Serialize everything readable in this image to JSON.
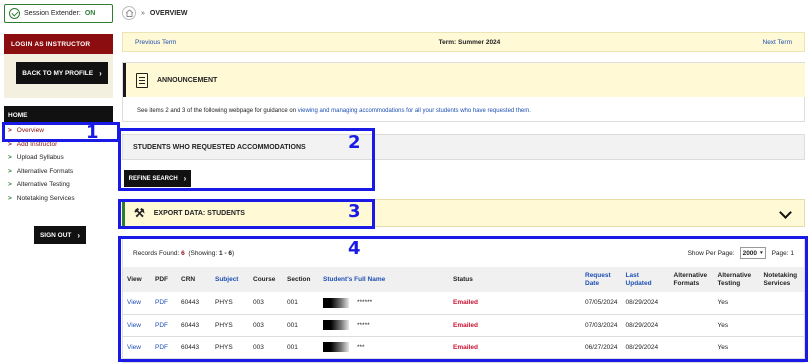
{
  "session": {
    "label": "Session Extender:",
    "state": "ON"
  },
  "sidebar": {
    "instructor_header": "LOGIN AS INSTRUCTOR",
    "back_button": "BACK TO MY PROFILE",
    "home_header": "HOME",
    "items": [
      {
        "label": "Overview"
      },
      {
        "label": "Add Instructor"
      },
      {
        "label": "Upload Syllabus"
      },
      {
        "label": "Alternative Formats"
      },
      {
        "label": "Alternative Testing"
      },
      {
        "label": "Notetaking Services"
      }
    ],
    "signout": "SIGN OUT"
  },
  "breadcrumb": {
    "separator": "»",
    "page": "OVERVIEW"
  },
  "term": {
    "prev": "Previous Term",
    "current": "Term: Summer 2024",
    "next": "Next Term"
  },
  "announcement": {
    "title": "ANNOUNCEMENT",
    "text_before": "See items 2 and 3 of the following webpage for guidance on ",
    "link": "viewing and managing accommodations for all your students who have requested them."
  },
  "students_section": {
    "title": "STUDENTS WHO REQUESTED ACCOMMODATIONS",
    "refine": "REFINE SEARCH"
  },
  "export_section": {
    "title": "EXPORT DATA: STUDENTS"
  },
  "records": {
    "found_label": "Records Found:",
    "found": "6",
    "showing_open": "(Showing:",
    "showing_range": "1 - 6",
    "showing_close": ")",
    "per_page_label": "Show Per Page:",
    "per_page": "2000",
    "page": "Page: 1"
  },
  "table": {
    "headers": [
      "View",
      "PDF",
      "CRN",
      "Subject",
      "Course",
      "Section",
      "Student's Full Name",
      "Status",
      "Request Date",
      "Last Updated",
      "Alternative Formats",
      "Alternative Testing",
      "Notetaking Services"
    ],
    "rows": [
      {
        "view": "View",
        "pdf": "PDF",
        "crn": "60443",
        "subject": "PHYS",
        "course": "003",
        "section": "001",
        "name": "******",
        "status": "Emailed",
        "request": "07/05/2024",
        "updated": "08/29/2024",
        "formats": "",
        "testing": "Yes",
        "notetaking": ""
      },
      {
        "view": "View",
        "pdf": "PDF",
        "crn": "60443",
        "subject": "PHYS",
        "course": "003",
        "section": "001",
        "name": "*****",
        "status": "Emailed",
        "request": "07/03/2024",
        "updated": "08/29/2024",
        "formats": "",
        "testing": "Yes",
        "notetaking": ""
      },
      {
        "view": "View",
        "pdf": "PDF",
        "crn": "60443",
        "subject": "PHYS",
        "course": "003",
        "section": "001",
        "name": "***",
        "status": "Emailed",
        "request": "06/27/2024",
        "updated": "08/29/2024",
        "formats": "",
        "testing": "Yes",
        "notetaking": ""
      }
    ]
  },
  "annotations": [
    "1",
    "2",
    "3",
    "4"
  ],
  "colors": {
    "brand_red": "#8b0d10",
    "accent_green": "#2e7d32",
    "link_blue": "#1e4fb3",
    "annotation_blue": "#1a1ae6",
    "status_red": "#c8102e"
  }
}
